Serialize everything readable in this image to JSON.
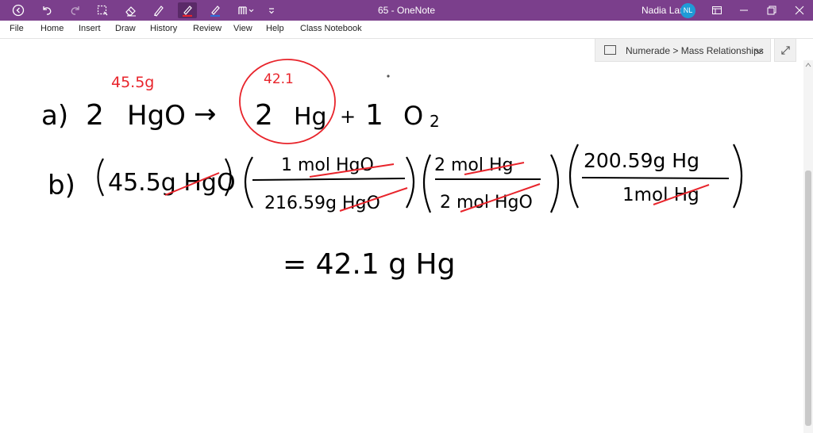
{
  "titlebar": {
    "title": "65  -  OneNote",
    "user_name": "Nadia Lara",
    "user_initials": "NL",
    "accent_color": "#7b3f8c",
    "icons": [
      "back-icon",
      "undo-icon",
      "redo-icon",
      "lasso-select-icon",
      "eraser-icon",
      "pen-icon",
      "red-pen-icon",
      "highlighter-icon",
      "pen-gallery-icon",
      "customize-toolbar-icon"
    ]
  },
  "menu": {
    "items": [
      "File",
      "Home",
      "Insert",
      "Draw",
      "History",
      "Review",
      "View",
      "Help",
      "Class Notebook"
    ]
  },
  "breadcrumb": {
    "text": "Numerade > Mass Relationships"
  },
  "notes": {
    "ink_black": "#000000",
    "ink_red": "#e8242b",
    "a_label": "a)",
    "a_coef_hgo": "2",
    "a_hgo": "HgO",
    "a_arrow": "→",
    "a_coef_hg": "2",
    "a_hg": "Hg",
    "a_plus": "+",
    "a_coef_o2": "1",
    "a_o": "O",
    "a_o2_sub": "2",
    "a_mass_hgo": "45.5g",
    "a_mass_hg": "42.1",
    "b_label": "b)",
    "b_given": "45.5g HgO",
    "b_f1_num": "1 mol HgO",
    "b_f1_den": "216.59g HgO",
    "b_f2_num": "2 mol Hg",
    "b_f2_den": "2 mol HgO",
    "b_f3_num": "200.59g Hg",
    "b_f3_den": "1mol Hg",
    "result": "= 42.1 g Hg"
  }
}
